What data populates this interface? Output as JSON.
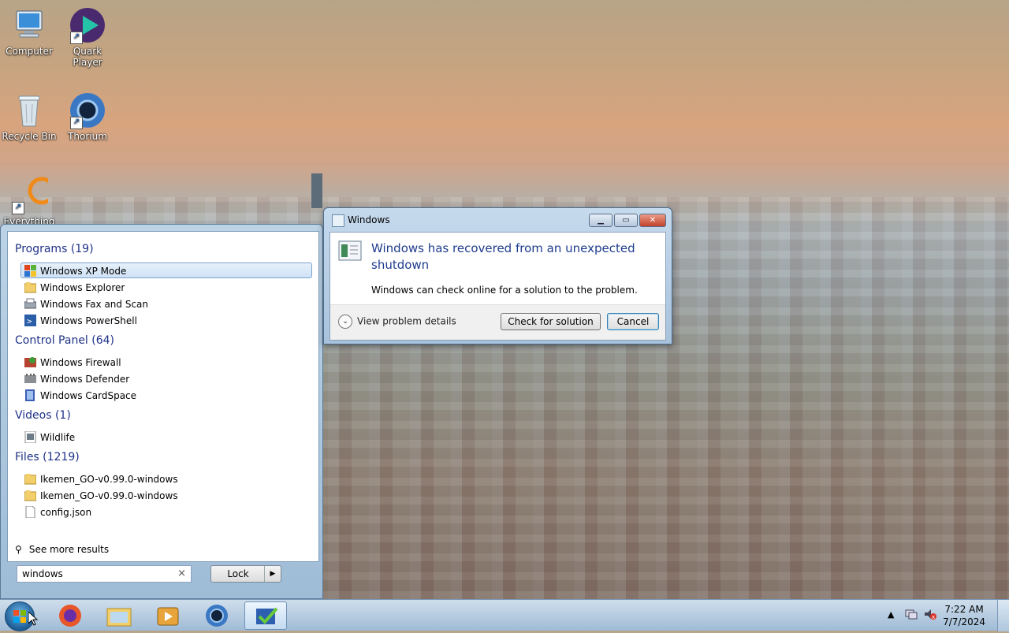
{
  "desktop": {
    "icons": [
      {
        "label": "Computer"
      },
      {
        "label": "Quark Player"
      },
      {
        "label": "Recycle Bin"
      },
      {
        "label": "Thorium"
      },
      {
        "label": "Everything"
      }
    ]
  },
  "start_menu": {
    "groups": [
      {
        "title": "Programs (19)",
        "items": [
          "Windows XP Mode",
          "Windows Explorer",
          "Windows Fax and Scan",
          "Windows PowerShell"
        ]
      },
      {
        "title": "Control Panel (64)",
        "items": [
          "Windows Firewall",
          "Windows Defender",
          "Windows CardSpace"
        ]
      },
      {
        "title": "Videos (1)",
        "items": [
          "Wildlife"
        ]
      },
      {
        "title": "Files (1219)",
        "items": [
          "Ikemen_GO-v0.99.0-windows",
          "Ikemen_GO-v0.99.0-windows",
          "config.json"
        ]
      }
    ],
    "see_more": "See more results",
    "search_value": "windows",
    "clear_glyph": "×",
    "lock_label": "Lock",
    "lock_arrow": "▶"
  },
  "dialog": {
    "title": "Windows",
    "heading": "Windows has recovered from an unexpected shutdown",
    "message": "Windows can check online for a solution to the problem.",
    "details": "View problem details",
    "check_button": "Check for solution",
    "cancel_button": "Cancel",
    "minimize_glyph": "▁",
    "maximize_glyph": "▭",
    "close_glyph": "✕",
    "chevron_glyph": "⌄"
  },
  "taskbar": {
    "clock_time": "7:22 AM",
    "clock_date": "7/7/2024",
    "tray_arrow": "▲"
  },
  "colors": {
    "accent": "#1e3c8e",
    "group_header": "#1e3287"
  }
}
